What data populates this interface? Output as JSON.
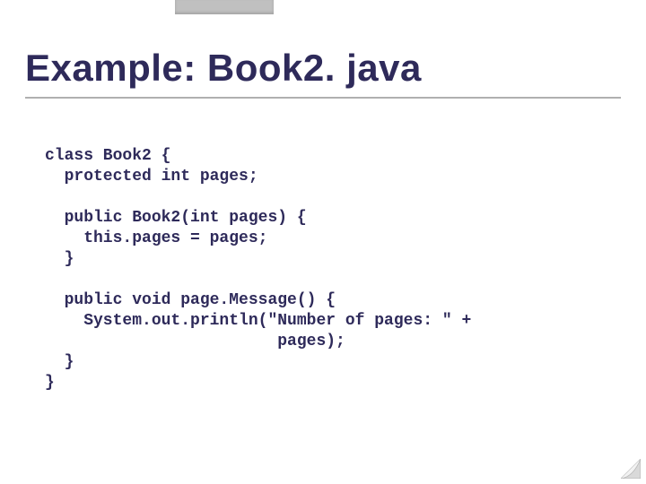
{
  "slide": {
    "title": "Example: Book2. java",
    "code_lines": [
      "class Book2 {",
      "  protected int pages;",
      "",
      "  public Book2(int pages) {",
      "    this.pages = pages;",
      "  }",
      "",
      "  public void page.Message() {",
      "    System.out.println(\"Number of pages: \" +",
      "                        pages);",
      "  }",
      "}"
    ]
  }
}
